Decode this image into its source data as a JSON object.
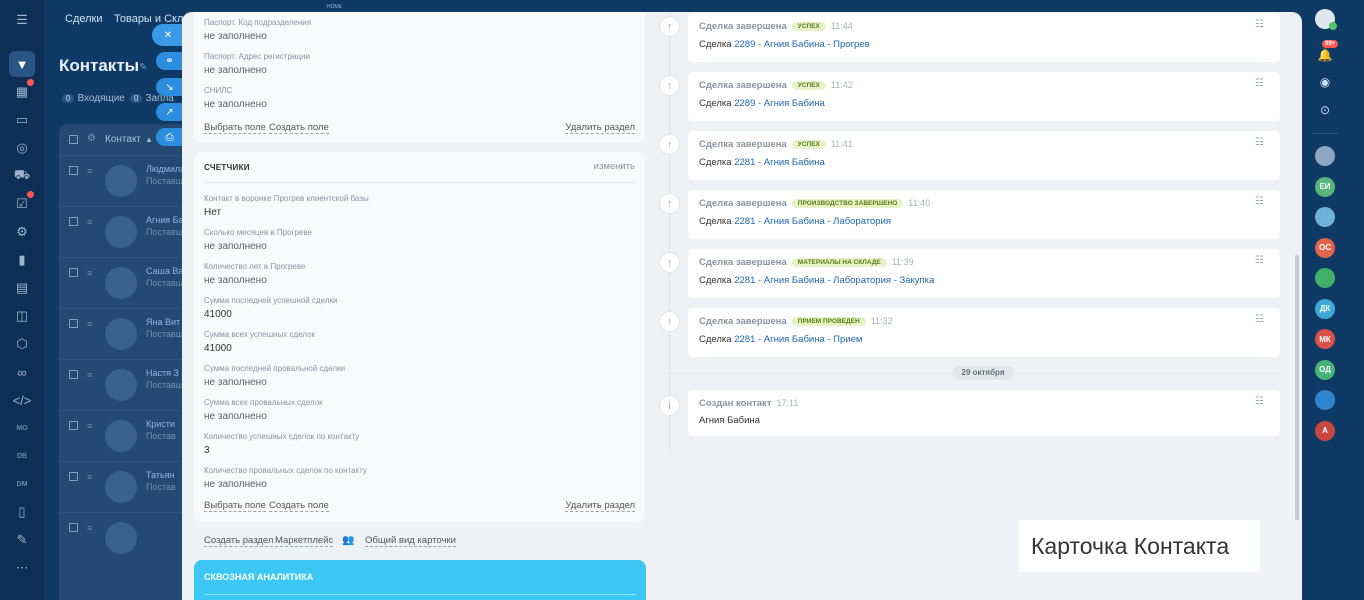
{
  "topnav": {
    "items": [
      "Сделки",
      "Товары и Склад"
    ],
    "logo_text": "HOME"
  },
  "page": {
    "title": "Контакты",
    "filters": [
      {
        "count": "0",
        "label": "Входящие"
      },
      {
        "count": "0",
        "label": "Запла"
      }
    ]
  },
  "grid": {
    "header_label": "Контакт",
    "rows": [
      {
        "name": "Людмила Аврамк",
        "sub": "Поставщ"
      },
      {
        "name": "Агния Ба",
        "sub": "Поставщ"
      },
      {
        "name": "Саша Ва",
        "sub": "Поставщ"
      },
      {
        "name": "Яна Вит",
        "sub": "Поставщ"
      },
      {
        "name": "Настя З",
        "sub": "Поставщ"
      },
      {
        "name": "Кристи",
        "sub": "Постав"
      },
      {
        "name": "Татьян",
        "sub": "Постав"
      },
      {
        "name": "",
        "sub": ""
      }
    ]
  },
  "card_top": {
    "fields": [
      {
        "label": "Паспорт. Код подразделения",
        "value": "не заполнено"
      },
      {
        "label": "Паспорт. Адрес регистрации",
        "value": "не заполнено"
      },
      {
        "label": "СНИЛС",
        "value": "не заполнено"
      }
    ],
    "select_field": "Выбрать поле",
    "create_field": "Создать поле",
    "delete_section": "Удалить раздел"
  },
  "card_counters": {
    "title": "СЧЕТЧИКИ",
    "edit": "изменить",
    "fields": [
      {
        "label": "Контакт в воронке Прогрев клиентской базы",
        "value": "Нет"
      },
      {
        "label": "Сколько месяцев в Прогреве",
        "value": "не заполнено"
      },
      {
        "label": "Количество лет в Прогреве",
        "value": "не заполнено"
      },
      {
        "label": "Сумма последней успешной сделки",
        "value": "41000"
      },
      {
        "label": "Сумма всех успешных сделок",
        "value": "41000"
      },
      {
        "label": "Сумма последней провальной сделки",
        "value": "не заполнено"
      },
      {
        "label": "Сумма всех провальных сделок",
        "value": "не заполнено"
      },
      {
        "label": "Количество успешных сделок по контакту",
        "value": "3"
      },
      {
        "label": "Количество провальных сделок по контакту",
        "value": "не заполнено"
      }
    ],
    "select_field": "Выбрать поле",
    "create_field": "Создать поле",
    "delete_section": "Удалить раздел"
  },
  "footer_links": {
    "create_section": "Создать раздел",
    "marketplace": "Маркетплейс",
    "common_view": "Общий вид карточки"
  },
  "analytics": {
    "title": "СКВОЗНАЯ АНАЛИТИКА"
  },
  "timeline": {
    "items": [
      {
        "head": "Сделка завершена",
        "badge": "успех",
        "time": "11:44",
        "prefix": "Сделка",
        "link": "2289 - Агния Бабина - Прогрев"
      },
      {
        "head": "Сделка завершена",
        "badge": "успех",
        "time": "11:42",
        "prefix": "Сделка",
        "link": "2289 - Агния Бабина"
      },
      {
        "head": "Сделка завершена",
        "badge": "успех",
        "time": "11:41",
        "prefix": "Сделка",
        "link": "2281 - Агния Бабина"
      },
      {
        "head": "Сделка завершена",
        "badge": "производство завершено",
        "time": "11:40",
        "prefix": "Сделка",
        "link": "2281 - Агния Бабина - Лаборатория"
      },
      {
        "head": "Сделка завершена",
        "badge": "материалы на складе",
        "time": "11:39",
        "prefix": "Сделка",
        "link": "2281 - Агния Бабина - Лаборатория - Закупка"
      },
      {
        "head": "Сделка завершена",
        "badge": "прием проведен",
        "time": "11:32",
        "prefix": "Сделка",
        "link": "2281 - Агния Бабина - Прием"
      }
    ],
    "date_separator": "29 октября",
    "created": {
      "head": "Создан контакт",
      "time": "17:11",
      "body": "Агния Бабина"
    }
  },
  "caption": "Карточка Контакта",
  "right_rail": {
    "notif_count": "99+",
    "avatars": [
      {
        "initials": "",
        "color": "#8fa6c0"
      },
      {
        "initials": "ЕИ",
        "color": "#55b57a"
      },
      {
        "initials": "",
        "color": "#6fb2d9"
      },
      {
        "initials": "ОС",
        "color": "#e1654a"
      },
      {
        "initials": "",
        "color": "#43b06a"
      },
      {
        "initials": "ДК",
        "color": "#3ea8d8"
      },
      {
        "initials": "МК",
        "color": "#d9504a"
      },
      {
        "initials": "ОД",
        "color": "#48b27a"
      },
      {
        "initials": "",
        "color": "#2f84d0"
      },
      {
        "initials": "А",
        "color": "#c9473f"
      }
    ]
  },
  "colors": {
    "accent": "#3bc8f5",
    "link": "#2067b0",
    "badge_bg": "#e6f3c5",
    "panel_bg": "#eef2f4"
  }
}
